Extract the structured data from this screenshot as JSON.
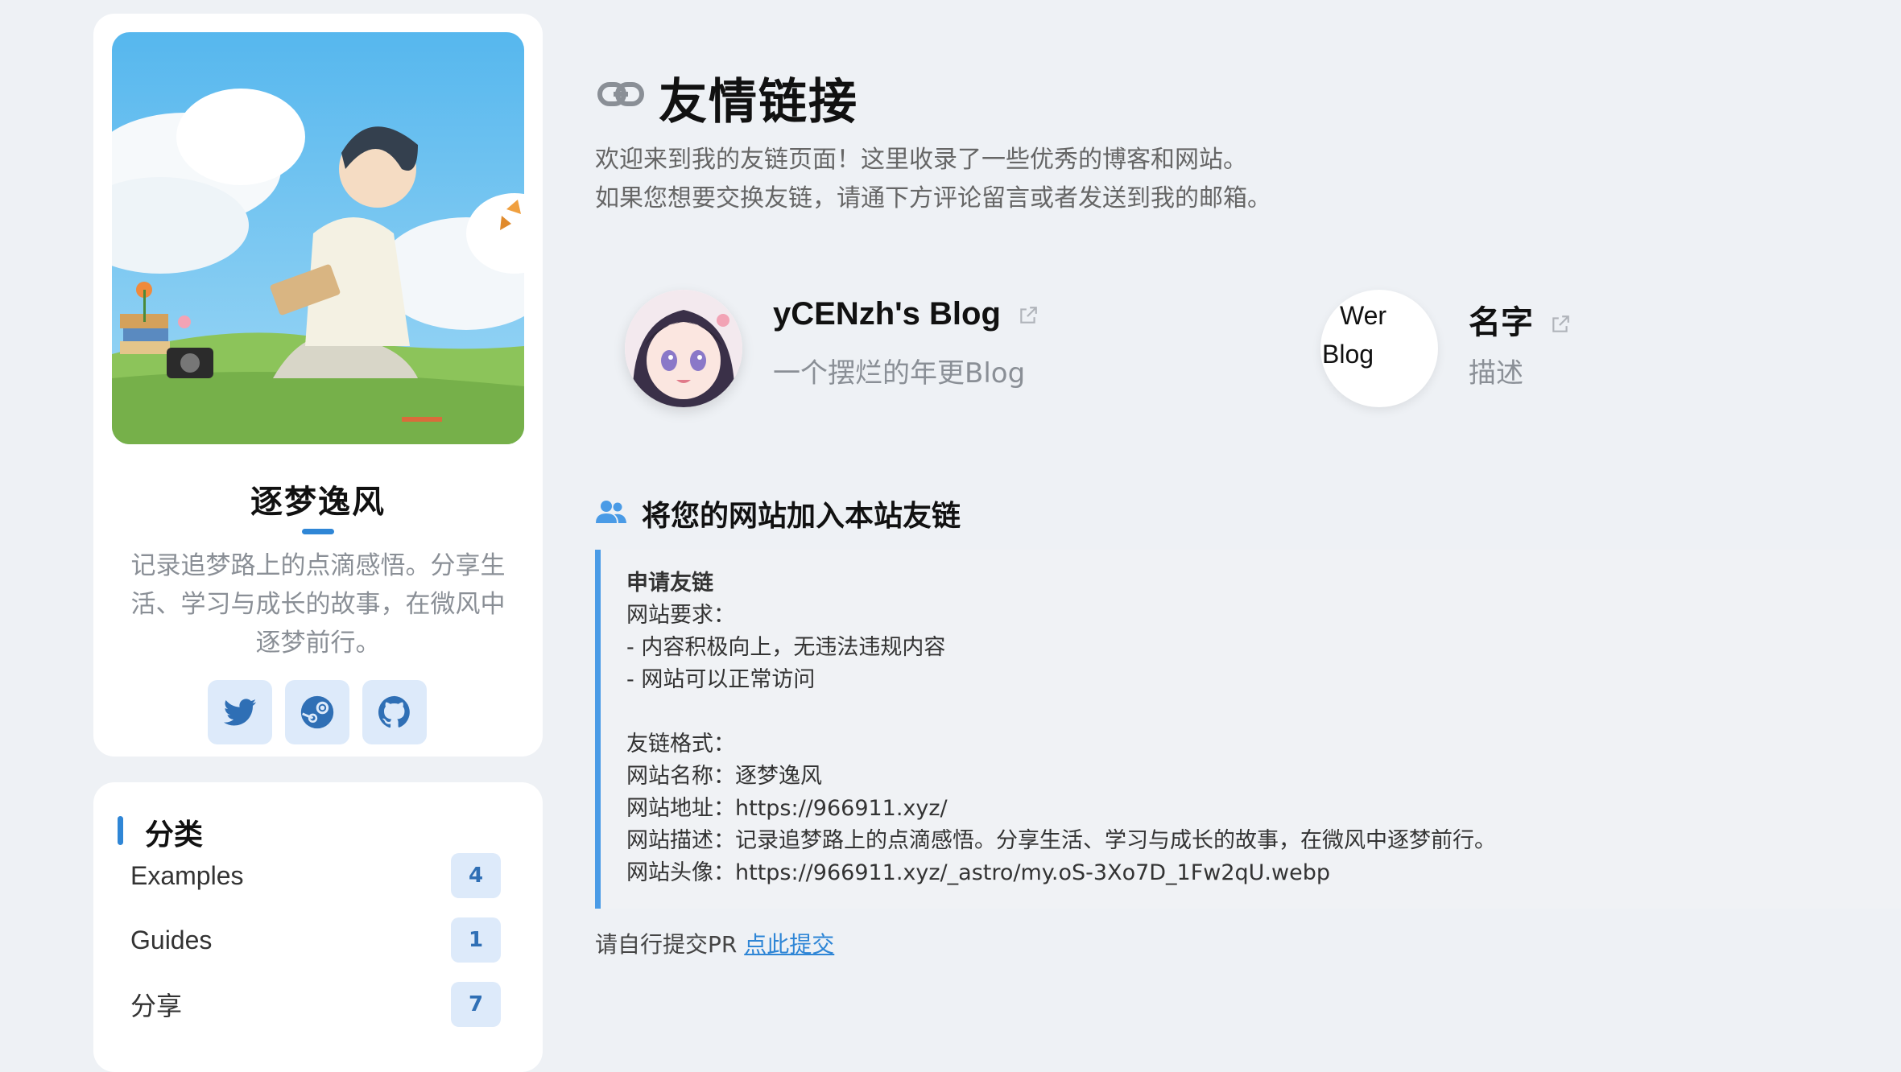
{
  "profile": {
    "name": "逐梦逸风",
    "bio": "记录追梦路上的点滴感悟。分享生活、学习与成长的故事，在微风中逐梦前行。",
    "socials": [
      {
        "icon": "twitter-icon"
      },
      {
        "icon": "steam-icon"
      },
      {
        "icon": "github-icon"
      }
    ]
  },
  "categories": {
    "title": "分类",
    "items": [
      {
        "label": "Examples",
        "count": "4"
      },
      {
        "label": "Guides",
        "count": "1"
      },
      {
        "label": "分享",
        "count": "7"
      }
    ]
  },
  "page": {
    "title": "友情链接",
    "intro_line1": "欢迎来到我的友链页面！这里收录了一些优秀的博客和网站。",
    "intro_line2": "如果您想要交换友链，请通下方评论留言或者发送到我的邮箱。"
  },
  "friends": [
    {
      "name": "yCENzh's Blog",
      "desc": "一个摆烂的年更Blog"
    },
    {
      "name": "名字",
      "desc": "描述",
      "avatar_alt_line1": "Wer",
      "avatar_alt_line2": "Blog"
    }
  ],
  "apply": {
    "section_title": "将您的网站加入本站友链",
    "heading": "申请友链",
    "lines": [
      "网站要求：",
      "- 内容积极向上，无违法违规内容",
      "- 网站可以正常访问",
      "",
      "友链格式：",
      "网站名称：逐梦逸风",
      "网站地址：https://966911.xyz/",
      "网站描述：记录追梦路上的点滴感悟。分享生活、学习与成长的故事，在微风中逐梦前行。",
      "网站头像：https://966911.xyz/_astro/my.oS-3Xo7D_1Fw2qU.webp"
    ]
  },
  "footer": {
    "text": "请自行提交PR ",
    "link": "点此提交"
  },
  "colors": {
    "accent": "#2f86d6",
    "background": "#eef1f5",
    "card": "#ffffff",
    "badge_bg": "#ddeafa"
  }
}
